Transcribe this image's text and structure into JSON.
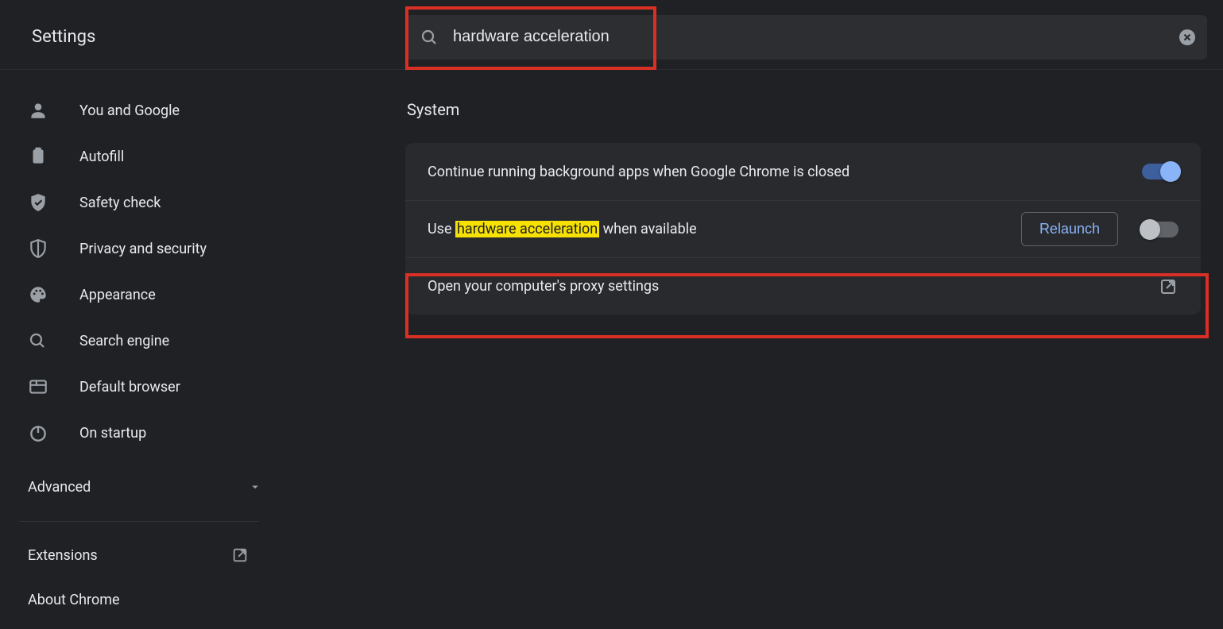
{
  "header": {
    "title": "Settings",
    "search_value": "hardware acceleration"
  },
  "nav": {
    "items": [
      {
        "label": "You and Google"
      },
      {
        "label": "Autofill"
      },
      {
        "label": "Safety check"
      },
      {
        "label": "Privacy and security"
      },
      {
        "label": "Appearance"
      },
      {
        "label": "Search engine"
      },
      {
        "label": "Default browser"
      },
      {
        "label": "On startup"
      }
    ],
    "advanced": "Advanced",
    "extensions": "Extensions",
    "about": "About Chrome"
  },
  "main": {
    "section_title": "System",
    "rows": {
      "bg_apps": "Continue running background apps when Google Chrome is closed",
      "hw_pre": "Use ",
      "hw_hl": "hardware acceleration",
      "hw_post": " when available",
      "relaunch": "Relaunch",
      "proxy": "Open your computer's proxy settings"
    }
  }
}
